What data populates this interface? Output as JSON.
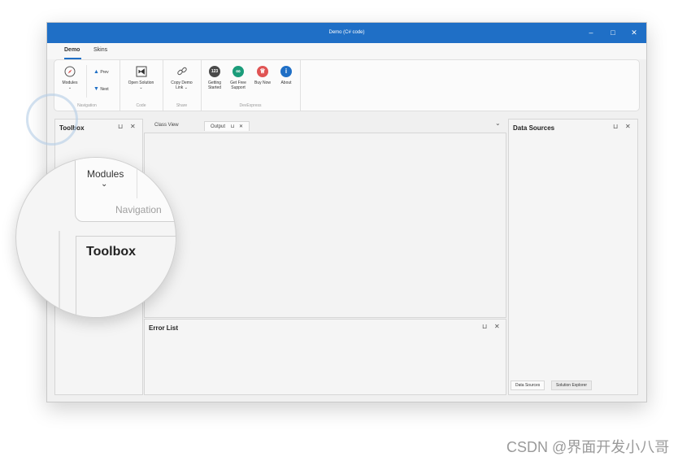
{
  "window": {
    "title": "Demo (C# code)"
  },
  "ribbon_tabs": [
    "Demo",
    "Skins"
  ],
  "groups": {
    "navigation": {
      "caption": "Navigation",
      "modules": "Modules",
      "prev": "Prev",
      "next": "Next"
    },
    "code": {
      "caption": "Code",
      "open_solution": "Open Solution"
    },
    "share": {
      "caption": "Share",
      "copy_demo_link_line1": "Copy Demo",
      "copy_demo_link_line2": "Link"
    },
    "devexpress": {
      "caption": "DevExpress",
      "getting_started_line1": "Getting",
      "getting_started_line2": "Started",
      "getting_started_badge": "123",
      "get_free_support_line1": "Get Free",
      "get_free_support_line2": "Support",
      "buy_now": "Buy Now",
      "about": "About",
      "about_glyph": "i"
    }
  },
  "panels": {
    "toolbox": "Toolbox",
    "data_sources": "Data Sources",
    "error_list": "Error List"
  },
  "doc_tabs": [
    "Class View",
    "Output"
  ],
  "bottom_tabs": [
    "Data Sources",
    "Solution Explorer"
  ],
  "magnifier": {
    "modules": "Modules",
    "navigation": "Navigation",
    "toolbox": "Toolbox"
  },
  "watermark": "CSDN @界面开发小八哥",
  "colors": {
    "titlebar": "#1f6fc6",
    "getting_started": "#4a4a4a",
    "get_free_support": "#1b9c7a",
    "buy_now": "#e05454",
    "about": "#1f6fc6"
  },
  "icons": {
    "modules": "compass-icon",
    "open_solution": "visual-studio-icon",
    "copy_demo_link": "link-icon",
    "getting_started": "number-badge-icon",
    "get_free_support": "support-icon",
    "buy_now": "crown-icon",
    "about": "info-icon"
  }
}
